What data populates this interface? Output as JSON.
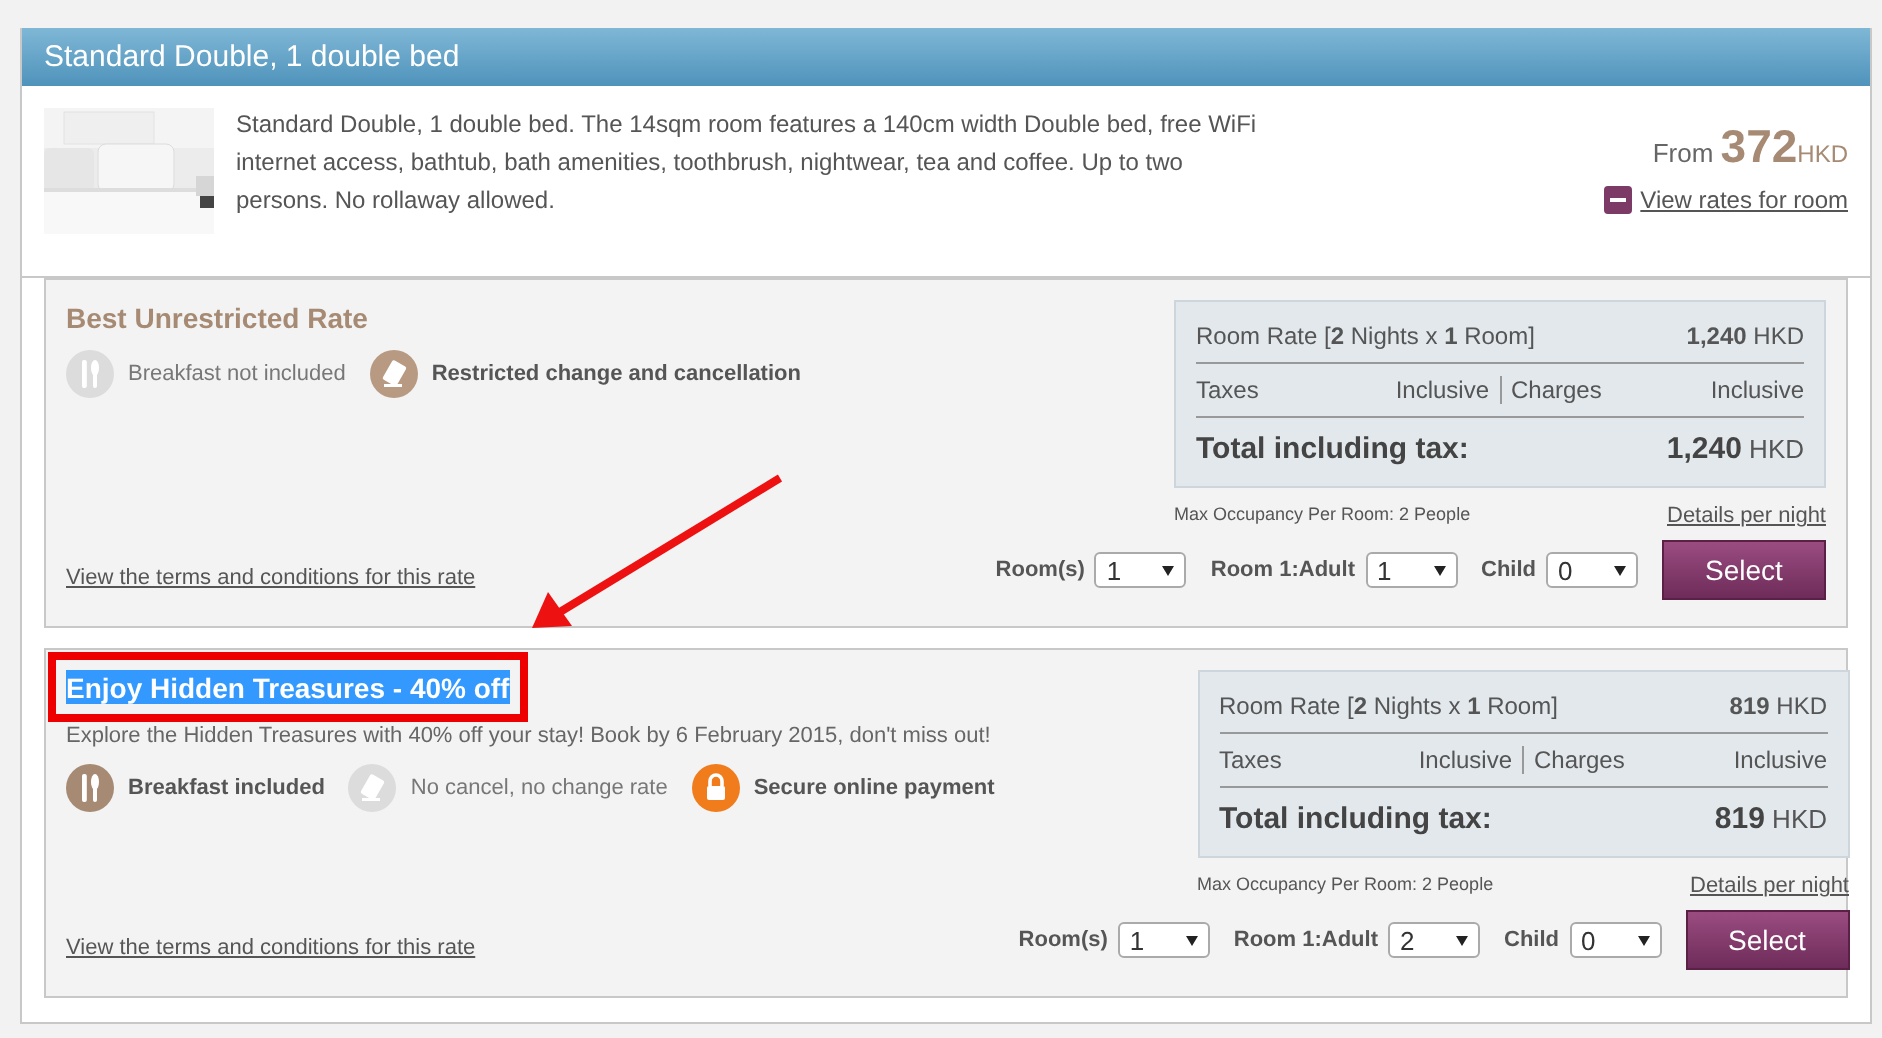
{
  "room": {
    "title": "Standard Double, 1 double bed",
    "description": "Standard Double, 1 double bed. The 14sqm room features a 140cm width Double bed, free WiFi internet access, bathtub, bath amenities, toothbrush, nightwear, tea and coffee. Up to two persons. No rollaway allowed.",
    "from_label": "From",
    "from_price": "372",
    "from_currency": "HKD",
    "view_rates": "View rates for room",
    "expanded": true
  },
  "rates": [
    {
      "name": "Best Unrestricted Rate",
      "highlighted": false,
      "features": [
        {
          "kind": "breakfast",
          "label": "Breakfast not included",
          "active": false
        },
        {
          "kind": "cancel",
          "label": "Restricted change and cancellation",
          "active": true
        }
      ],
      "terms_link": "View the terms and conditions for this rate",
      "room_rate_label": "Room Rate [**2** Nights x **1** Room]",
      "room_rate_value": "**1,240** HKD",
      "taxes_label": "Taxes",
      "taxes_value": "Inclusive",
      "charges_label": "Charges",
      "charges_value": "Inclusive",
      "total_label": "Total including tax:",
      "total_value": "**1,240** HKD",
      "occupancy": "Max Occupancy Per Room: 2 People",
      "details_link": "Details per night",
      "selects": [
        {
          "label": "Room(s)",
          "value": "1"
        },
        {
          "label": "Room 1:Adult",
          "value": "1"
        },
        {
          "label": "Child",
          "value": "0"
        }
      ],
      "button": "Select"
    },
    {
      "name": "Enjoy Hidden Treasures - 40% off",
      "highlighted": true,
      "description": "Explore the Hidden Treasures with 40% off your stay! Book by 6 February 2015, don't miss out!",
      "features": [
        {
          "kind": "breakfast",
          "label": "Breakfast included",
          "active": true
        },
        {
          "kind": "cancel",
          "label": "No cancel, no change rate",
          "active": false
        },
        {
          "kind": "lock",
          "label": "Secure online payment",
          "active": true
        }
      ],
      "terms_link": "View the terms and conditions for this rate",
      "room_rate_label": "Room Rate [**2** Nights x **1** Room]",
      "room_rate_value": "**819** HKD",
      "taxes_label": "Taxes",
      "taxes_value": "Inclusive",
      "charges_label": "Charges",
      "charges_value": "Inclusive",
      "total_label": "Total including tax:",
      "total_value": "**819** HKD",
      "occupancy": "Max Occupancy Per Room: 2 People",
      "details_link": "Details per night",
      "selects": [
        {
          "label": "Room(s)",
          "value": "1"
        },
        {
          "label": "Room 1:Adult",
          "value": "2"
        },
        {
          "label": "Child",
          "value": "0"
        }
      ],
      "button": "Select"
    }
  ]
}
